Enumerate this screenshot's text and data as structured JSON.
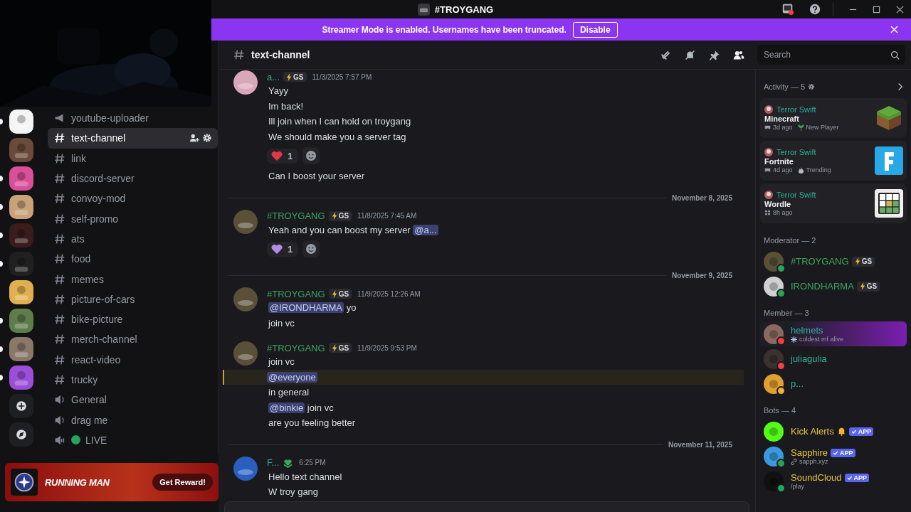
{
  "titlebar": {
    "title": "#TROYGANG"
  },
  "banner": {
    "text": "Streamer Mode is enabled. Usernames have been truncated.",
    "button": "Disable"
  },
  "servers": [
    {
      "color": "#f4f4f4",
      "unread": true
    },
    {
      "color": "#6b4a3a",
      "unread": false
    },
    {
      "color": "#d94f9a",
      "unread": true
    },
    {
      "color": "#c9a27a",
      "unread": true
    },
    {
      "color": "#3a1c1c",
      "unread": true
    },
    {
      "color": "#202020",
      "unread": true
    },
    {
      "color": "#e0b050",
      "unread": false
    },
    {
      "color": "#5f7d4a",
      "unread": true
    },
    {
      "color": "#8a7868",
      "unread": true
    },
    {
      "color": "#9b4fd9",
      "unread": true
    }
  ],
  "channels": [
    {
      "kind": "announcement",
      "name": "youtube-uploader",
      "selected": false
    },
    {
      "kind": "text",
      "name": "text-channel",
      "selected": true
    },
    {
      "kind": "text",
      "name": "link",
      "selected": false
    },
    {
      "kind": "text",
      "name": "discord-server",
      "selected": false
    },
    {
      "kind": "text",
      "name": "convoy-mod",
      "selected": false
    },
    {
      "kind": "text",
      "name": "self-promo",
      "selected": false
    },
    {
      "kind": "text",
      "name": "ats",
      "selected": false
    },
    {
      "kind": "text",
      "name": "food",
      "selected": false
    },
    {
      "kind": "text",
      "name": "memes",
      "selected": false
    },
    {
      "kind": "text",
      "name": "picture-of-cars",
      "selected": false
    },
    {
      "kind": "text",
      "name": "bike-picture",
      "selected": false
    },
    {
      "kind": "text",
      "name": "merch-channel",
      "selected": false
    },
    {
      "kind": "text",
      "name": "react-video",
      "selected": false
    },
    {
      "kind": "text",
      "name": "trucky",
      "selected": false
    },
    {
      "kind": "voice",
      "name": "General",
      "selected": false
    },
    {
      "kind": "voice",
      "name": "drag me",
      "selected": false
    },
    {
      "kind": "stage",
      "name": "LIVE",
      "selected": false,
      "color": "#23a55a"
    }
  ],
  "promo": {
    "title": "RUNNING MAN",
    "button": "Get Reward!"
  },
  "header": {
    "channel": "text-channel",
    "search": {
      "placeholder": "Search"
    }
  },
  "messages": [
    {
      "kind": "message",
      "author": "a...",
      "color": "#2fb07a",
      "tag": {
        "kind": "guild",
        "text": "GS"
      },
      "time": "11/3/2025 7:57 PM",
      "blocks": [
        {
          "kind": "line",
          "highlighted": false,
          "parts": [
            {
              "kind": "text",
              "text": "Yayy"
            }
          ]
        },
        {
          "kind": "line",
          "highlighted": false,
          "parts": [
            {
              "kind": "text",
              "text": "Im back!"
            }
          ]
        },
        {
          "kind": "line",
          "highlighted": false,
          "parts": [
            {
              "kind": "text",
              "text": "Ill join when I can hold on troygang"
            }
          ]
        },
        {
          "kind": "line",
          "highlighted": false,
          "parts": [
            {
              "kind": "text",
              "text": "We should make you a server tag"
            }
          ]
        },
        {
          "kind": "reactions",
          "items": [
            {
              "color": "#e5354a",
              "count": "1"
            }
          ]
        },
        {
          "kind": "line",
          "highlighted": false,
          "parts": [
            {
              "kind": "text",
              "text": "Can I boost your server"
            }
          ]
        }
      ]
    },
    {
      "kind": "divider",
      "text": "November 8, 2025"
    },
    {
      "kind": "message",
      "author": "#TROYGANG",
      "color": "#3ba55d",
      "tag": {
        "kind": "guild",
        "text": "GS"
      },
      "time": "11/8/2025 7:45 AM",
      "blocks": [
        {
          "kind": "line",
          "highlighted": false,
          "parts": [
            {
              "kind": "text",
              "text": "Yeah and you can boost my server "
            },
            {
              "kind": "mention",
              "text": "@a..."
            }
          ]
        },
        {
          "kind": "reactions",
          "items": [
            {
              "color": "#b48ae8",
              "count": "1"
            }
          ]
        }
      ]
    },
    {
      "kind": "divider",
      "text": "November 9, 2025"
    },
    {
      "kind": "message",
      "author": "#TROYGANG",
      "color": "#3ba55d",
      "tag": {
        "kind": "guild",
        "text": "GS"
      },
      "time": "11/9/2025 12:26 AM",
      "blocks": [
        {
          "kind": "line",
          "highlighted": false,
          "parts": [
            {
              "kind": "mention",
              "text": "@IRONDHARMA"
            },
            {
              "kind": "text",
              "text": " yo"
            }
          ]
        },
        {
          "kind": "line",
          "highlighted": false,
          "parts": [
            {
              "kind": "text",
              "text": "join vc"
            }
          ]
        }
      ]
    },
    {
      "kind": "message",
      "author": "#TROYGANG",
      "color": "#3ba55d",
      "tag": {
        "kind": "guild",
        "text": "GS"
      },
      "time": "11/9/2025 9:53 PM",
      "blocks": [
        {
          "kind": "line",
          "highlighted": false,
          "parts": [
            {
              "kind": "text",
              "text": "join vc"
            }
          ]
        },
        {
          "kind": "line",
          "highlighted": true,
          "parts": [
            {
              "kind": "mention",
              "text": "@everyone"
            }
          ]
        },
        {
          "kind": "line",
          "highlighted": false,
          "parts": [
            {
              "kind": "text",
              "text": "in general"
            }
          ]
        },
        {
          "kind": "line",
          "highlighted": false,
          "parts": [
            {
              "kind": "mention",
              "text": "@binkie"
            },
            {
              "kind": "text",
              "text": " join vc"
            }
          ]
        },
        {
          "kind": "line",
          "highlighted": false,
          "parts": [
            {
              "kind": "text",
              "text": "are you feeling better"
            }
          ]
        }
      ]
    },
    {
      "kind": "divider",
      "text": "November 11, 2025"
    },
    {
      "kind": "message",
      "author": "F...",
      "color": "#2fb09a",
      "tag": {
        "kind": "emblem"
      },
      "time": "6:25 PM",
      "blocks": [
        {
          "kind": "line",
          "highlighted": false,
          "parts": [
            {
              "kind": "text",
              "text": "Hello text channel"
            }
          ]
        },
        {
          "kind": "line",
          "highlighted": false,
          "parts": [
            {
              "kind": "text",
              "text": "W troy gang"
            }
          ]
        }
      ]
    }
  ],
  "activity": {
    "label": "Activity — 5",
    "cards": [
      {
        "user": "Terror Swift",
        "game": "Minecraft",
        "art": {
          "kind": "block"
        },
        "meta": {
          "kind": "game",
          "time": "3d ago"
        },
        "extra": {
          "kind": "new",
          "text": "New Player"
        }
      },
      {
        "user": "Terror Swift",
        "game": "Fortnite",
        "art": {
          "kind": "tile"
        },
        "meta": {
          "kind": "game",
          "time": "4d ago"
        },
        "extra": {
          "kind": "trending",
          "text": "Trending"
        }
      },
      {
        "user": "Terror Swift",
        "game": "Wordle",
        "art": {
          "kind": "grid"
        },
        "meta": {
          "kind": "app",
          "time": "8h ago"
        }
      }
    ]
  },
  "groups": [
    {
      "label": "Moderator — 2",
      "members": [
        {
          "name": "#TROYGANG",
          "color": "#3ba55d",
          "status": {
            "kind": "online"
          },
          "nameplate": false,
          "tag": {
            "kind": "guild",
            "text": "GS"
          }
        },
        {
          "name": "IRONDHARMA",
          "color": "#3ba55d",
          "status": {
            "kind": "online"
          },
          "nameplate": false,
          "tag": {
            "kind": "guild",
            "text": "GS"
          }
        }
      ]
    },
    {
      "label": "Member — 3",
      "members": [
        {
          "name": "helmets",
          "color": "#2fb09a",
          "status": {
            "kind": "dnd"
          },
          "nameplate": true,
          "sub": {
            "kind": "status",
            "text": "coldest mf alive"
          }
        },
        {
          "name": "juliagulia",
          "color": "#2fb09a",
          "status": {
            "kind": "dnd"
          },
          "nameplate": false
        },
        {
          "name": "p...",
          "color": "#2fb09a",
          "status": {
            "kind": "idle"
          },
          "nameplate": false
        }
      ]
    },
    {
      "label": "Bots — 4",
      "members": [
        {
          "name": "Kick Alerts",
          "color": "#e8c547",
          "nameplate": false,
          "bell": true,
          "tag": {
            "kind": "app",
            "text": "APP"
          }
        },
        {
          "name": "Sapphire",
          "color": "#e8c547",
          "status": {
            "kind": "online"
          },
          "nameplate": false,
          "bell": false,
          "tag": {
            "kind": "app",
            "text": "APP"
          },
          "sub": {
            "kind": "link",
            "text": "sapph.xyz"
          }
        },
        {
          "name": "SoundCloud",
          "color": "#e8c547",
          "status": {
            "kind": "online"
          },
          "nameplate": false,
          "bell": false,
          "tag": {
            "kind": "app",
            "text": "APP"
          },
          "sub": {
            "kind": "plain",
            "text": "/play"
          }
        }
      ]
    }
  ]
}
